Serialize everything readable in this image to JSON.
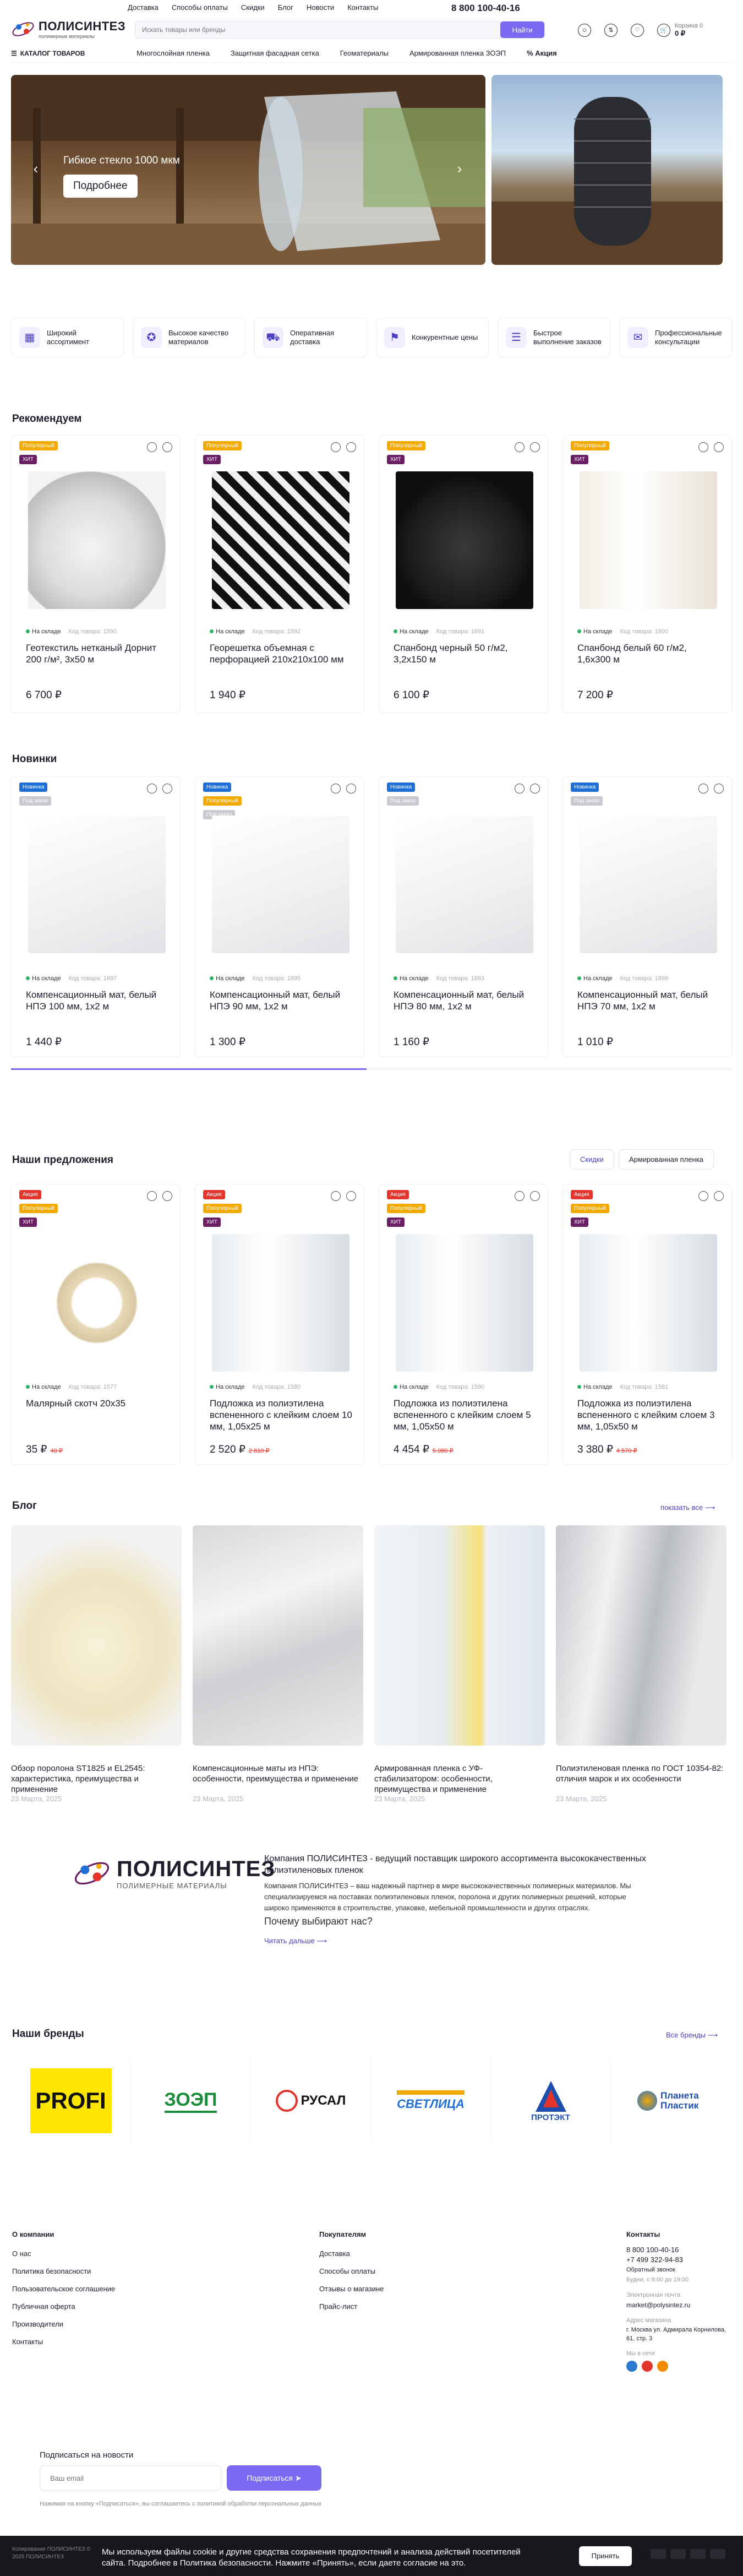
{
  "top_nav": [
    "Доставка",
    "Способы оплаты",
    "Скидки",
    "Блог",
    "Новости",
    "Контакты"
  ],
  "phone": "8 800 100-40-16",
  "logo": {
    "name": "ПОЛИСИНТЕЗ",
    "tagline": "полимерные материалы"
  },
  "search": {
    "placeholder": "Искать товары или бренды",
    "button": "Найти"
  },
  "cart": {
    "label": "Корзина 0",
    "sum": "0 ₽"
  },
  "catalog_button": "КАТАЛОГ ТОВАРОВ",
  "categories": [
    "Многослойная пленка",
    "Защитная фасадная сетка",
    "Геоматериалы",
    "Армированная пленка ЗОЭП"
  ],
  "promo_link": "Акция",
  "hero": {
    "title": "Гибкое стекло 1000 мкм",
    "button": "Подробнее"
  },
  "features": [
    "Широкий ассортимент",
    "Высокое качество материалов",
    "Оперативная доставка",
    "Конкурентные цены",
    "Быстрое выполнение заказов",
    "Профессиональные консультации"
  ],
  "recommend": {
    "title": "Рекомендуем",
    "items": [
      {
        "badges": [
          "Популярный",
          "ХИТ"
        ],
        "stock": "На складе",
        "code": "Код товара: 1590",
        "name": "Геотекстиль нетканый Дорнит 200 г/м², 3х50 м",
        "price": "6 700 ₽"
      },
      {
        "badges": [
          "Популярный",
          "ХИТ"
        ],
        "stock": "На складе",
        "code": "Код товара: 1592",
        "name": "Георешетка объемная с перфорацией 210х210х100 мм",
        "price": "1 940 ₽"
      },
      {
        "badges": [
          "Популярный",
          "ХИТ"
        ],
        "stock": "На складе",
        "code": "Код товара: 1691",
        "name": "Спанбонд черный 50 г/м2, 3,2х150 м",
        "price": "6 100 ₽"
      },
      {
        "badges": [
          "Популярный",
          "ХИТ"
        ],
        "stock": "На складе",
        "code": "Код товара: 1800",
        "name": "Спанбонд белый 60 г/м2, 1,6х300 м",
        "price": "7 200 ₽"
      }
    ]
  },
  "news": {
    "title": "Новинки",
    "items": [
      {
        "badges": [
          "Новинка",
          "Под заказ"
        ],
        "stock": "На складе",
        "code": "Код товара: 1897",
        "name": "Компенсационный мат, белый НПЭ 100 мм, 1х2 м",
        "price": "1 440 ₽"
      },
      {
        "badges": [
          "Новинка",
          "Популярный",
          "Под заказ"
        ],
        "stock": "На складе",
        "code": "Код товара: 1895",
        "name": "Компенсационный мат, белый НПЭ 90 мм, 1х2 м",
        "price": "1 300 ₽"
      },
      {
        "badges": [
          "Новинка",
          "Под заказ"
        ],
        "stock": "На складе",
        "code": "Код товара: 1893",
        "name": "Компенсационный мат, белый НПЭ 80 мм, 1х2 м",
        "price": "1 160 ₽"
      },
      {
        "badges": [
          "Новинка",
          "Под заказ"
        ],
        "stock": "На складе",
        "code": "Код товара: 1899",
        "name": "Компенсационный мат, белый НПЭ 70 мм, 1х2 м",
        "price": "1 010 ₽"
      }
    ]
  },
  "offers": {
    "title": "Наши предложения",
    "tabs": [
      "Скидки",
      "Армированная пленка"
    ],
    "items": [
      {
        "badges": [
          "Акция",
          "Популярный",
          "ХИТ"
        ],
        "stock": "На складе",
        "code": "Код товара: 1577",
        "name": "Малярный скотч 20х35",
        "price": "35 ₽",
        "old_price": "40 ₽"
      },
      {
        "badges": [
          "Акция",
          "Популярный",
          "ХИТ"
        ],
        "stock": "На складе",
        "code": "Код товара: 1580",
        "name": "Подложка из полиэтилена вспененного с клейким слоем 10 мм, 1,05х25 м",
        "price": "2 520 ₽",
        "old_price": "2 810 ₽"
      },
      {
        "badges": [
          "Акция",
          "Популярный",
          "ХИТ"
        ],
        "stock": "На складе",
        "code": "Код товара: 1590",
        "name": "Подложка из полиэтилена вспененного с клейким слоем 5 мм, 1,05х50 м",
        "price": "4 454 ₽",
        "old_price": "5 080 ₽"
      },
      {
        "badges": [
          "Акция",
          "Популярный",
          "ХИТ"
        ],
        "stock": "На складе",
        "code": "Код товара: 1581",
        "name": "Подложка из полиэтилена вспененного с клейким слоем 3 мм, 1,05х50 м",
        "price": "3 380 ₽",
        "old_price": "4 570 ₽"
      }
    ]
  },
  "blog": {
    "title": "Блог",
    "show_all": "показать все",
    "posts": [
      {
        "title": "Обзор поролона ST1825 и EL2545: характеристика, преимущества и применение",
        "date": "23 Марта, 2025"
      },
      {
        "title": "Компенсационные маты из НПЭ: особенности, преимущества и применение",
        "date": "23 Марта, 2025"
      },
      {
        "title": "Армированная пленка с УФ-стабилизатором: особенности, преимущества и применение",
        "date": "23 Марта, 2025"
      },
      {
        "title": "Полиэтиленовая пленка по ГОСТ 10354-82: отличия марок и их особенности",
        "date": "23 Марта, 2025"
      }
    ]
  },
  "about": {
    "logo_name": "ПОЛИСИНТЕЗ",
    "logo_tagline": "ПОЛИМЕРНЫЕ МАТЕРИАЛЫ",
    "heading": "Компания ПОЛИСИНТЕЗ - ведущий поставщик широкого ассортимента высококачественных полиэтиленовых пленок",
    "text": "Компания ПОЛИСИНТЕЗ – ваш надежный партнер в мире высококачественных полимерных материалов. Мы специализируемся на поставках полиэтиленовых пленок, поролона и других полимерных решений, которые широко применяются в строительстве, упаковке, мебельной промышленности и других отраслях.",
    "subheading": "Почему выбирают нас?",
    "more": "Читать дальше"
  },
  "brands": {
    "title": "Наши бренды",
    "show_all": "Все бренды",
    "items": [
      "PROFI",
      "ЗОЭП",
      "РУСАЛ",
      "СВЕТЛИЦА",
      "ПРОТЭКТ",
      "Планета Пластик"
    ]
  },
  "footer": {
    "company": {
      "title": "О компании",
      "links": [
        "О нас",
        "Политика безопасности",
        "Пользовательское соглашение",
        "Публичная оферта",
        "Производители",
        "Контакты"
      ]
    },
    "buyers": {
      "title": "Покупателям",
      "links": [
        "Доставка",
        "Способы оплаты",
        "Отзывы о магазине",
        "Прайс-лист"
      ]
    },
    "contacts": {
      "title": "Контакты",
      "phone1": "8 800 100-40-16",
      "phone2": "+7 499 322-94-83",
      "callback": "Обратный звонок",
      "hours": "Будни, с 9:00 до 19:00",
      "email_label": "Электронная почта",
      "email": "market@polysintez.ru",
      "address_label": "Адрес магазина",
      "address": "г. Москва ул. Адмирала Корнилова, 61, стр. 3",
      "social_label": "Мы в сети"
    },
    "subscribe": {
      "title": "Подписаться на новости",
      "placeholder": "Ваш email",
      "button": "Подписаться",
      "note": "Нажимая на кнопку «Подписаться», вы соглашаетесь с политикой обработки персональных данных"
    }
  },
  "cookie": {
    "text": "Мы используем файлы cookie и другие средства сохранения предпочтений и анализа действий посетителей сайта. Подробнее в Политика безопасности. Нажмите «Принять», если даете согласие на это.",
    "accept": "Принять",
    "copyright": "Копирование ПОЛИСИНТЕЗ © 2025 ПОЛИСИНТЕЗ"
  }
}
